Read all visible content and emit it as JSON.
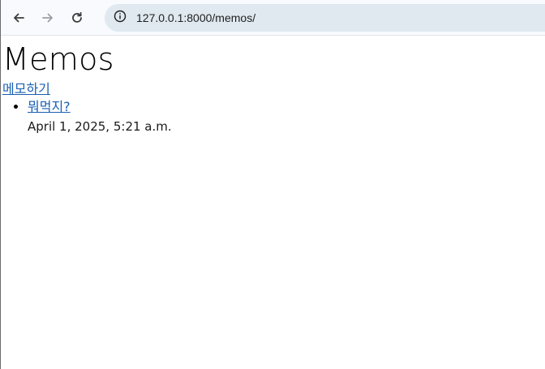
{
  "browser": {
    "url": "127.0.0.1:8000/memos/",
    "url_host": "127.0.0.1",
    "url_rest": ":8000/memos/",
    "icons": {
      "back": "back-arrow-icon",
      "forward": "forward-arrow-icon",
      "reload": "reload-icon",
      "site_info": "info-icon"
    }
  },
  "page": {
    "title": "Memos",
    "new_memo_link": "메모하기",
    "memos": [
      {
        "title": "뭐먹지?",
        "date": "April 1, 2025, 5:21 a.m."
      }
    ]
  },
  "colors": {
    "link": "#1a5fb4",
    "omnibox": "#dfe9ef",
    "toolbar": "#f8fafd"
  }
}
